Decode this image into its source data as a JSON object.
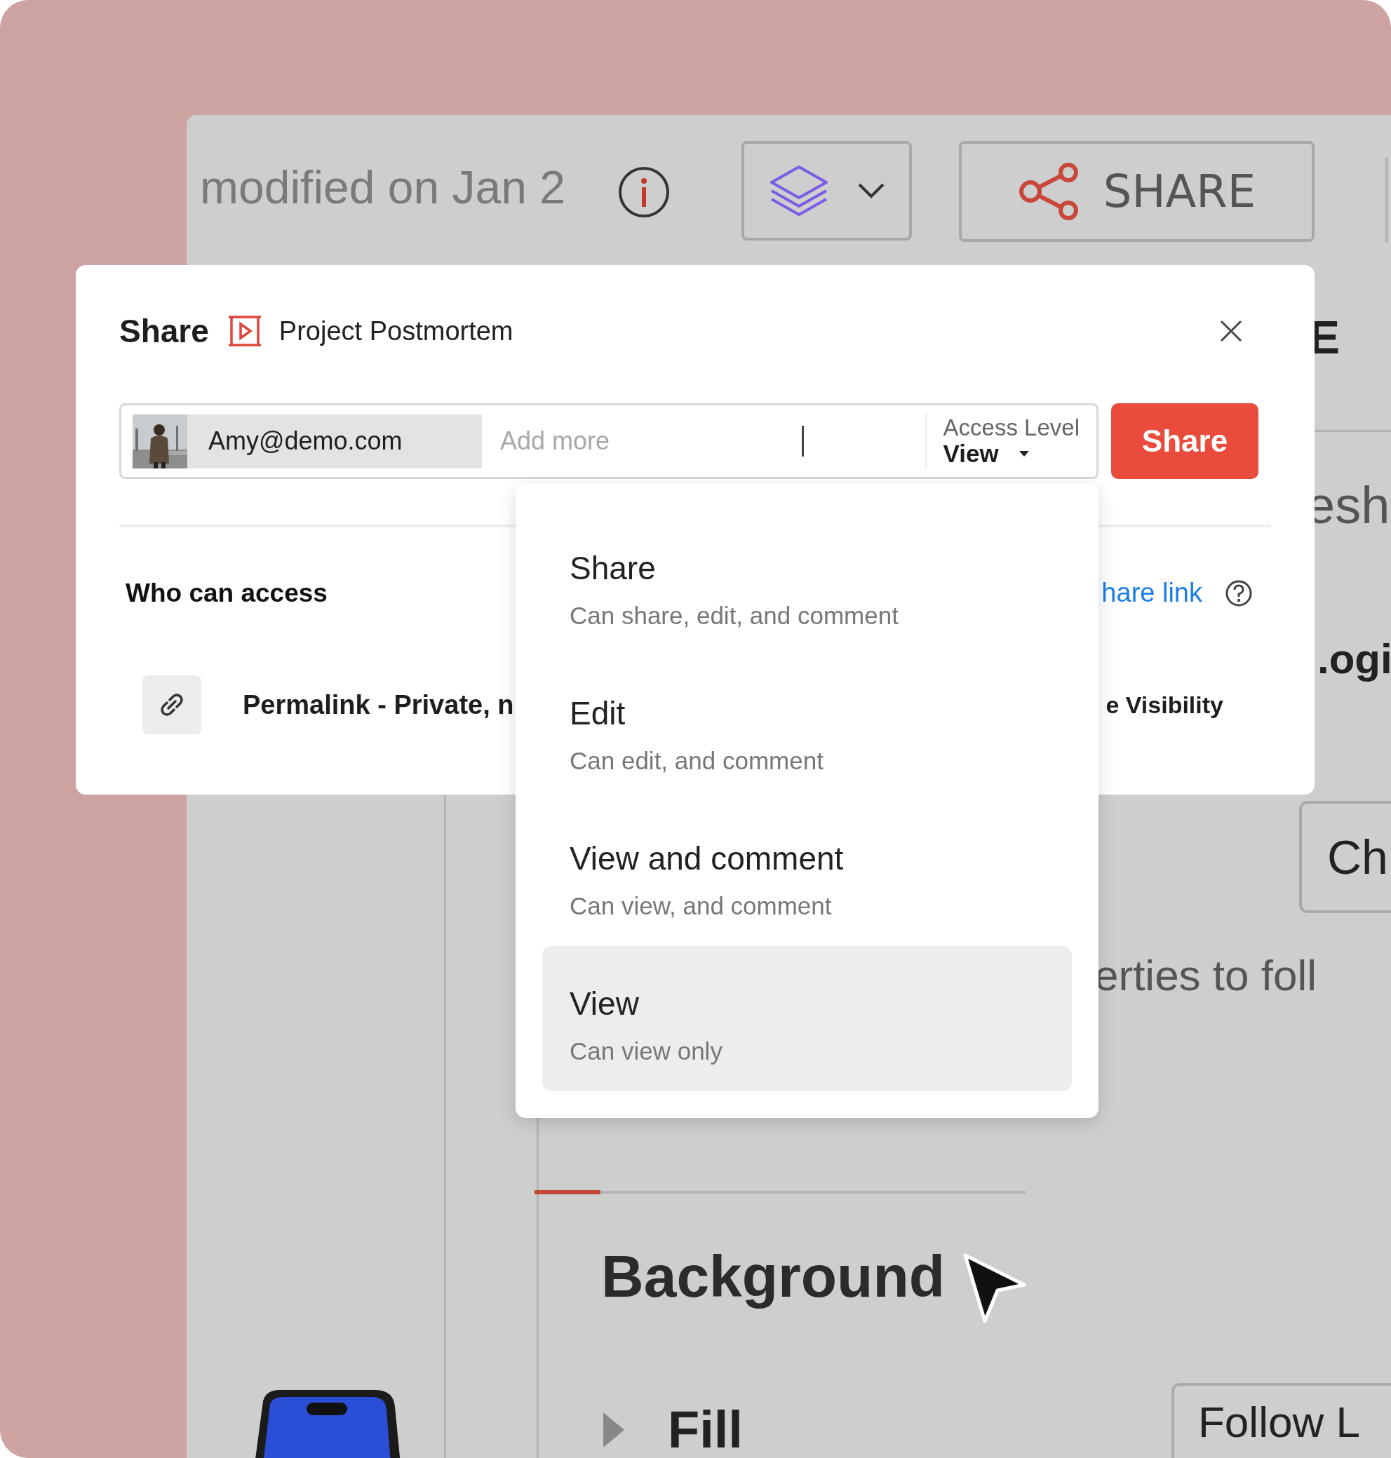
{
  "app": {
    "modified_text": "modified on Jan 2",
    "share_button": {
      "label": "SHARE"
    },
    "side_texts": [
      "E",
      "esh",
      ".ogi",
      "erties to foll"
    ],
    "ch_button": {
      "label": "Ch"
    },
    "section_title": "Background",
    "fill_row": {
      "label": "Fill",
      "expanded": false
    },
    "follow_button": {
      "label": "Follow L"
    }
  },
  "dialog": {
    "title": "Share",
    "document_name": "Project Postmortem",
    "recipient_chip": {
      "email": "Amy@demo.com"
    },
    "add_field": {
      "placeholder": "Add more"
    },
    "access_level": {
      "label": "Access Level",
      "value": "View"
    },
    "share_button": {
      "label": "Share"
    },
    "who_can_access": "Who can access",
    "share_link": "hare link",
    "permalink_text": "Permalink - Private, n",
    "visibility_text": "e Visibility"
  },
  "access_menu": {
    "items": [
      {
        "label": "Share",
        "description": "Can share, edit, and comment",
        "selected": false
      },
      {
        "label": "Edit",
        "description": "Can edit, and comment",
        "selected": false
      },
      {
        "label": "View and comment",
        "description": "Can view, and comment",
        "selected": false
      },
      {
        "label": "View",
        "description": "Can view only",
        "selected": true
      }
    ]
  }
}
